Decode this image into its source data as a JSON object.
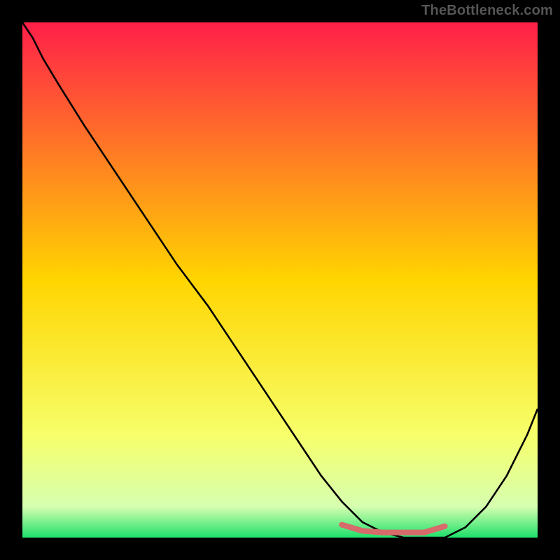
{
  "watermark": "TheBottleneck.com",
  "chart_data": {
    "type": "line",
    "title": "",
    "xlabel": "",
    "ylabel": "",
    "xlim": [
      0,
      100
    ],
    "ylim": [
      0,
      100
    ],
    "grid": false,
    "legend": false,
    "gradient_stops": [
      {
        "offset": 0.0,
        "color": "#ff1f49"
      },
      {
        "offset": 0.5,
        "color": "#ffd500"
      },
      {
        "offset": 0.8,
        "color": "#f7ff6a"
      },
      {
        "offset": 0.94,
        "color": "#d6ffb0"
      },
      {
        "offset": 1.0,
        "color": "#1ee06a"
      }
    ],
    "series": [
      {
        "name": "bottleneck-curve",
        "color": "#000000",
        "stroke_width": 2,
        "x": [
          0,
          2,
          4,
          7,
          12,
          18,
          24,
          30,
          36,
          42,
          48,
          54,
          58,
          62,
          66,
          70,
          74,
          78,
          82,
          86,
          90,
          94,
          98,
          100
        ],
        "y": [
          100,
          97,
          93,
          88,
          80,
          71,
          62,
          53,
          45,
          36,
          27,
          18,
          12,
          7,
          3,
          1,
          0,
          0,
          0,
          2,
          6,
          12,
          20,
          25
        ]
      },
      {
        "name": "highlight-segment",
        "color": "#d76a6a",
        "stroke_width": 6,
        "x": [
          62,
          66,
          70,
          74,
          78,
          82
        ],
        "y": [
          2.5,
          1.3,
          1.0,
          1.0,
          1.0,
          2.2
        ]
      }
    ]
  }
}
